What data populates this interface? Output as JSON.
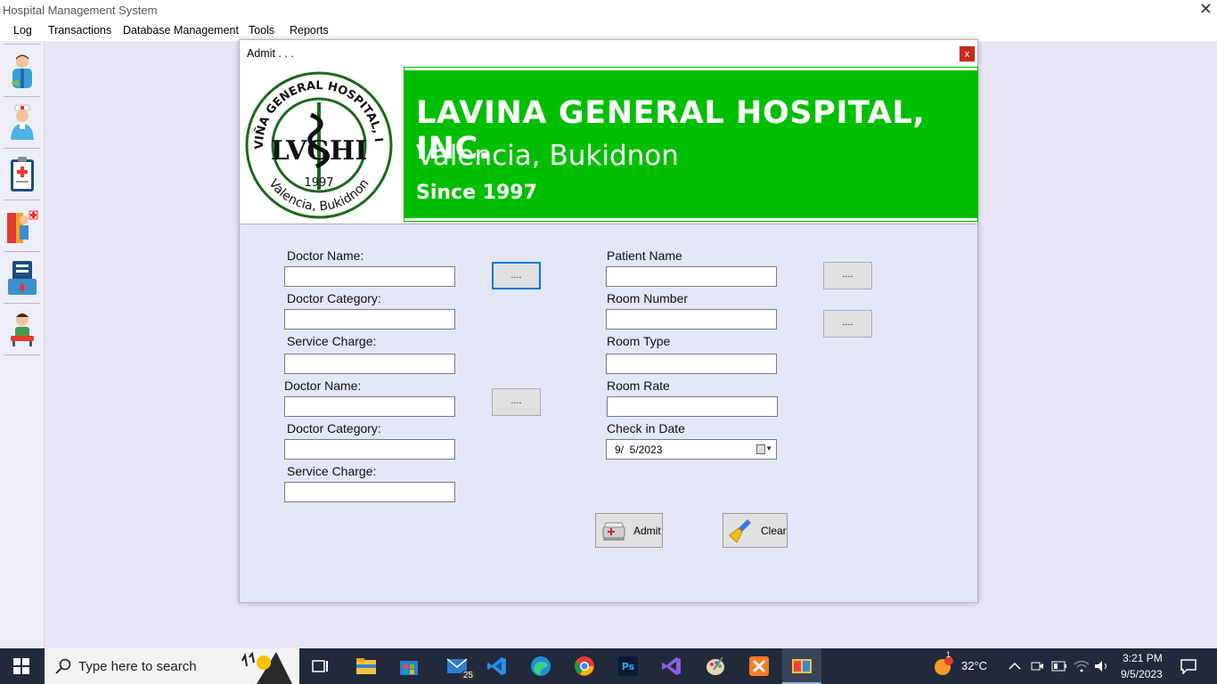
{
  "window": {
    "title": "Hospital Management System",
    "close": "✕"
  },
  "menu": [
    "Log",
    "Transactions",
    "Database Management",
    "Tools",
    "Reports"
  ],
  "sidebar": {
    "items": [
      "patient-icon",
      "nurse-icon",
      "clipboard-icon",
      "doctor-icon",
      "blood-bank-icon",
      "user-icon"
    ]
  },
  "dialog": {
    "title": "Admit . . .",
    "close": "x",
    "logo": {
      "ring_top": "LAVIÑA GENERAL HOSPITAL, INC.",
      "center": "LVGHI",
      "year": "1997",
      "ring_bottom": "Valencia, Bukidnon"
    },
    "banner": {
      "name": "LAVINA GENERAL HOSPITAL, INC.",
      "location": "Valencia, Bukidnon",
      "since": "Since 1997"
    },
    "left": {
      "doctor_name_1": "Doctor Name:",
      "doctor_category_1": "Doctor Category:",
      "service_charge_1": "Service Charge:",
      "doctor_name_2": "Doctor Name:",
      "doctor_category_2": "Doctor Category:",
      "service_charge_2": "Service Charge:"
    },
    "right": {
      "patient_name": "Patient Name",
      "room_number": "Room Number",
      "room_type": "Room Type",
      "room_rate": "Room Rate",
      "check_in_date": "Check in Date",
      "check_in_value": "9/  5/2023"
    },
    "dots": "....",
    "buttons": {
      "admit": "Admit",
      "clear": "Clear"
    }
  },
  "taskbar": {
    "search_placeholder": "Type here to search",
    "mail_badge": "25",
    "weather_badge": "1",
    "temperature": "32°C",
    "time": "3:21 PM",
    "date": "9/5/2023"
  },
  "colors": {
    "banner_green": "#00bf00",
    "close_red": "#c42b1c",
    "taskbar": "#202a3a"
  }
}
